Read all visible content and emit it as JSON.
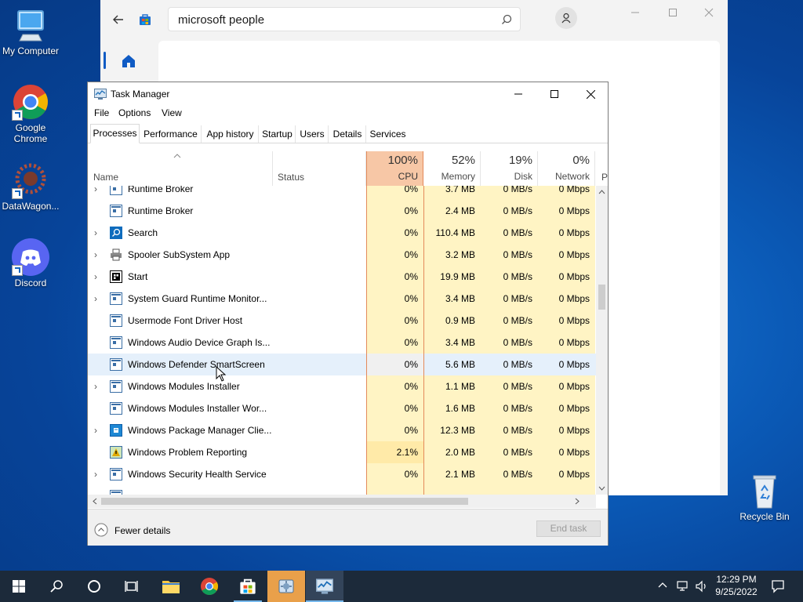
{
  "desktop": {
    "icons": [
      {
        "label": "My Computer"
      },
      {
        "label": "Google Chrome"
      },
      {
        "label": "DataWagon..."
      },
      {
        "label": "Discord"
      },
      {
        "label": "Recycle Bin"
      }
    ]
  },
  "store": {
    "search_value": "microsoft people",
    "nav_icon": "home-icon"
  },
  "task_manager": {
    "title": "Task Manager",
    "menu": [
      "File",
      "Options",
      "View"
    ],
    "tabs": [
      "Processes",
      "Performance",
      "App history",
      "Startup",
      "Users",
      "Details",
      "Services"
    ],
    "active_tab": "Processes",
    "columns": {
      "name": "Name",
      "status": "Status",
      "cpu": {
        "pct": "100%",
        "label": "CPU"
      },
      "memory": {
        "pct": "52%",
        "label": "Memory"
      },
      "disk": {
        "pct": "19%",
        "label": "Disk"
      },
      "network": {
        "pct": "0%",
        "label": "Network"
      },
      "power": "P"
    },
    "rows": [
      {
        "name": "Runtime Broker",
        "cpu": "0%",
        "mem": "3.7 MB",
        "disk": "0 MB/s",
        "net": "0 Mbps"
      },
      {
        "name": "Runtime Broker",
        "cpu": "0%",
        "mem": "2.4 MB",
        "disk": "0 MB/s",
        "net": "0 Mbps"
      },
      {
        "name": "Search",
        "cpu": "0%",
        "mem": "110.4 MB",
        "disk": "0 MB/s",
        "net": "0 Mbps"
      },
      {
        "name": "Spooler SubSystem App",
        "cpu": "0%",
        "mem": "3.2 MB",
        "disk": "0 MB/s",
        "net": "0 Mbps"
      },
      {
        "name": "Start",
        "cpu": "0%",
        "mem": "19.9 MB",
        "disk": "0 MB/s",
        "net": "0 Mbps"
      },
      {
        "name": "System Guard Runtime Monitor...",
        "cpu": "0%",
        "mem": "3.4 MB",
        "disk": "0 MB/s",
        "net": "0 Mbps"
      },
      {
        "name": "Usermode Font Driver Host",
        "cpu": "0%",
        "mem": "0.9 MB",
        "disk": "0 MB/s",
        "net": "0 Mbps"
      },
      {
        "name": "Windows Audio Device Graph Is...",
        "cpu": "0%",
        "mem": "3.4 MB",
        "disk": "0 MB/s",
        "net": "0 Mbps"
      },
      {
        "name": "Windows Defender SmartScreen",
        "cpu": "0%",
        "mem": "5.6 MB",
        "disk": "0 MB/s",
        "net": "0 Mbps"
      },
      {
        "name": "Windows Modules Installer",
        "cpu": "0%",
        "mem": "1.1 MB",
        "disk": "0 MB/s",
        "net": "0 Mbps"
      },
      {
        "name": "Windows Modules Installer Wor...",
        "cpu": "0%",
        "mem": "1.6 MB",
        "disk": "0 MB/s",
        "net": "0 Mbps"
      },
      {
        "name": "Windows Package Manager Clie...",
        "cpu": "0%",
        "mem": "12.3 MB",
        "disk": "0 MB/s",
        "net": "0 Mbps"
      },
      {
        "name": "Windows Problem Reporting",
        "cpu": "2.1%",
        "mem": "2.0 MB",
        "disk": "0 MB/s",
        "net": "0 Mbps"
      },
      {
        "name": "Windows Security Health Service",
        "cpu": "0%",
        "mem": "2.1 MB",
        "disk": "0 MB/s",
        "net": "0 Mbps"
      }
    ],
    "footer": {
      "fewer_details": "Fewer details",
      "end_task": "End task"
    }
  },
  "taskbar": {
    "time": "12:29 PM",
    "date": "9/25/2022"
  },
  "colors": {
    "cpu_header_bg": "#f7c7a6",
    "column_bg": "#fff4c4",
    "selected_row": "#e5f0fb",
    "taskbar": "#1c2a3a"
  }
}
